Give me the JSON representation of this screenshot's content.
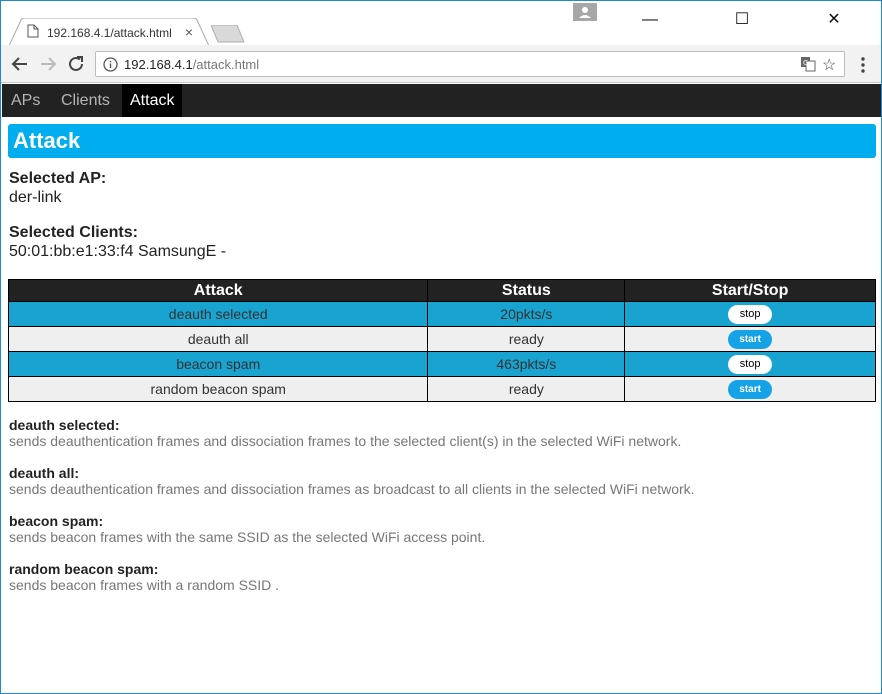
{
  "browser": {
    "tab_title": "192.168.4.1/attack.html",
    "tab_close": "×",
    "url_host": "192.168.4.1",
    "url_path": "/attack.html",
    "minimize": "—",
    "maximize": "☐",
    "close": "✕"
  },
  "menu": {
    "items": [
      {
        "label": "APs"
      },
      {
        "label": "Clients"
      },
      {
        "label": "Attack"
      }
    ],
    "active": "Attack"
  },
  "page": {
    "title": "Attack",
    "selected_ap_label": "Selected AP:",
    "selected_ap_value": "der-link",
    "selected_clients_label": "Selected Clients:",
    "selected_clients_value": "50:01:bb:e1:33:f4 SamsungE -"
  },
  "table": {
    "headers": [
      "Attack",
      "Status",
      "Start/Stop"
    ],
    "rows": [
      {
        "attack": "deauth selected",
        "status": "20pkts/s",
        "button": "stop"
      },
      {
        "attack": "deauth all",
        "status": "ready",
        "button": "start"
      },
      {
        "attack": "beacon spam",
        "status": "463pkts/s",
        "button": "stop"
      },
      {
        "attack": "random beacon spam",
        "status": "ready",
        "button": "start"
      }
    ]
  },
  "descriptions": [
    {
      "title": "deauth selected:",
      "text": "sends deauthentication frames and dissociation frames to the selected client(s) in the selected WiFi network."
    },
    {
      "title": "deauth all:",
      "text": "sends deauthentication frames and dissociation frames as broadcast to all clients in the selected WiFi network."
    },
    {
      "title": "beacon spam:",
      "text": "sends beacon frames with the same SSID as the selected WiFi access point."
    },
    {
      "title": "random beacon spam:",
      "text": "sends beacon frames with a random SSID ."
    }
  ],
  "colors": {
    "accent": "#00aeef",
    "menu_bg": "#222222",
    "row_active": "#19a3d0",
    "status_running": "#e52d2d",
    "status_ready": "#2ecc40",
    "start_button": "#15a2e6"
  },
  "icons": {
    "tab": "document-icon",
    "back": "back-arrow-icon",
    "forward": "forward-arrow-icon",
    "reload": "reload-icon",
    "info": "info-icon",
    "translate": "translate-icon",
    "bookmark": "star-icon",
    "menu": "kebab-menu-icon",
    "profile": "profile-icon"
  }
}
